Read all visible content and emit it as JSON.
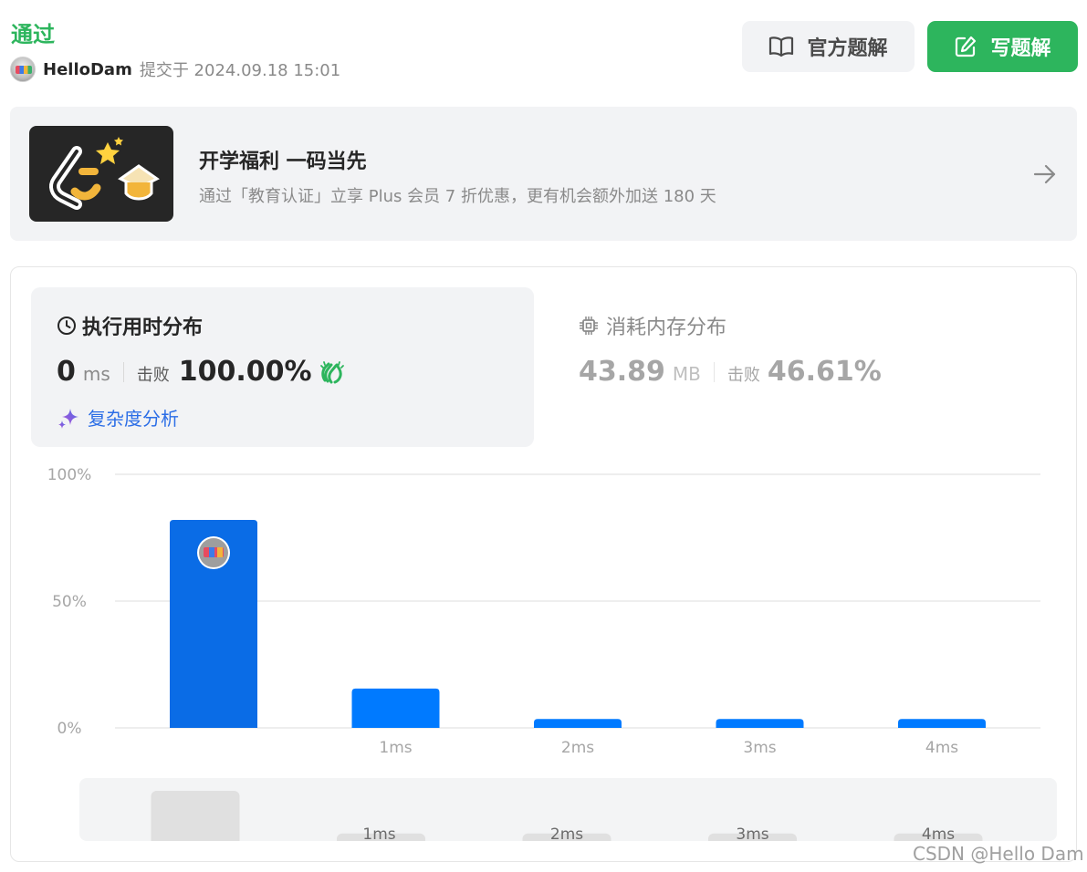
{
  "header": {
    "status": "通过",
    "username": "HelloDam",
    "submit_info": "提交于 2024.09.18 15:01",
    "solution_btn": "官方题解",
    "write_btn": "写题解"
  },
  "banner": {
    "title": "开学福利 一码当先",
    "subtitle": "通过「教育认证」立享 Plus 会员 7 折优惠，更有机会额外加送 180 天"
  },
  "runtime": {
    "title": "执行用时分布",
    "value": "0",
    "unit": "ms",
    "beat_label": "击败",
    "beat_value": "100.00%",
    "complexity_link": "复杂度分析"
  },
  "memory": {
    "title": "消耗内存分布",
    "value": "43.89",
    "unit": "MB",
    "beat_label": "击败",
    "beat_value": "46.61%"
  },
  "chart_data": {
    "type": "bar",
    "categories": [
      "",
      "1ms",
      "2ms",
      "3ms",
      "4ms"
    ],
    "values": [
      82,
      15.5,
      3.5,
      3.5,
      3.5
    ],
    "ylim": [
      0,
      100
    ],
    "yticks": [
      "100%",
      "50%",
      "0%"
    ],
    "highlight_index": 0,
    "minimap_values": [
      20,
      3,
      3,
      3,
      3
    ],
    "colors": {
      "bar": "#007aff",
      "highlight": "#0a6ce6",
      "minimap_bar": "#e0e0e0"
    }
  },
  "watermark": "CSDN @Hello Dam",
  "colors": {
    "accent": "#2db55d",
    "link": "#2c6ee6"
  }
}
